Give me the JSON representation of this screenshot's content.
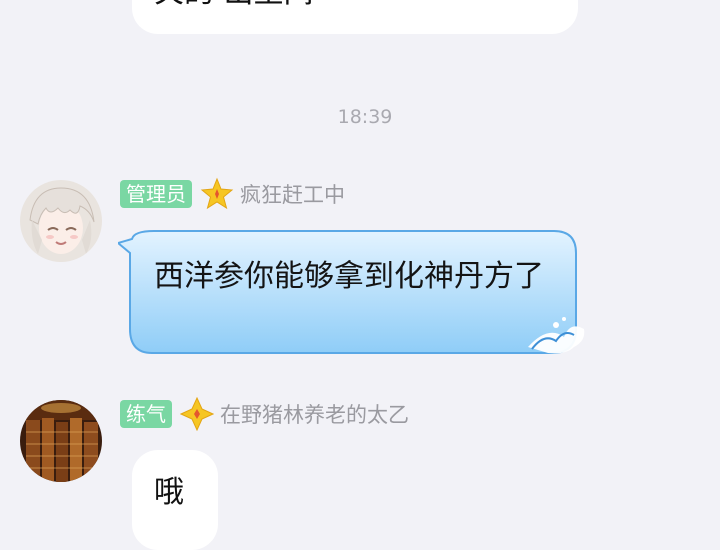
{
  "messages": {
    "prev": {
      "text": "关的 出生间"
    },
    "timestamp": "18:39",
    "msg1": {
      "role_badge": "管理员",
      "nickname": "疯狂赶工中",
      "text": "西洋参你能够拿到化神丹方了"
    },
    "msg2": {
      "role_badge": "练气",
      "nickname": "在野猪林养老的太乙",
      "text": "哦"
    }
  },
  "colors": {
    "background": "#f2f2f7",
    "badge_green": "#7ad7a3",
    "bubble_blue_light": "#dff1ff",
    "bubble_blue_dark": "#8ecdf8",
    "bubble_border": "#5aa8e6",
    "star_gold": "#f6c623"
  },
  "icons": {
    "admin_rank": "gold-star-icon",
    "member_rank": "gold-diamond-star-icon"
  }
}
